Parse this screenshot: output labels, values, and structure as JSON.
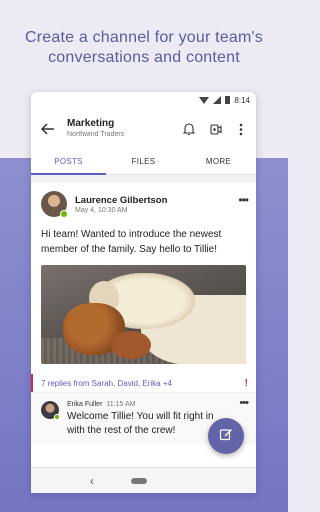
{
  "headline": {
    "line1": "Create a channel for your team's",
    "line2": "conversations and content"
  },
  "status_bar": {
    "time": "8:14"
  },
  "app_bar": {
    "title": "Marketing",
    "subtitle": "Northwind Traders"
  },
  "tabs": [
    {
      "label": "POSTS",
      "active": true
    },
    {
      "label": "FILES",
      "active": false
    },
    {
      "label": "MORE",
      "active": false
    }
  ],
  "post": {
    "author": "Laurence Gilbertson",
    "time": "May 4, 10:30 AM",
    "text": "Hi team! Wanted to introduce the newest member of the family. Say hello to Tillie!",
    "replies_summary": "7 replies from Sarah, David, Erika +4",
    "important_marker": "!"
  },
  "reply": {
    "author": "Erika Fuller",
    "time": "11:15 AM",
    "text": "Welcome Tillie! You will fit right in with the rest of the crew!"
  },
  "icons": {
    "back": "back-arrow-icon",
    "bell": "bell-icon",
    "meeting": "video-meeting-icon",
    "more": "more-vertical-icon",
    "compose": "compose-icon"
  },
  "colors": {
    "accent": "#5b5fc7",
    "fab": "#6264a7",
    "presence": "#6bb700",
    "important": "#c4314b"
  }
}
